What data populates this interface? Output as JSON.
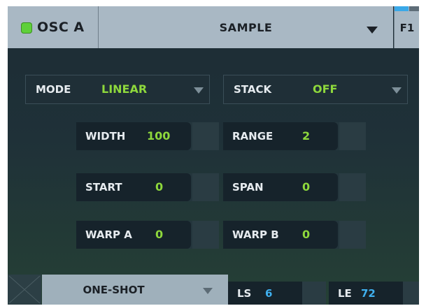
{
  "header": {
    "osc_label": "OSC A",
    "osc_enabled": true,
    "sample_label": "SAMPLE",
    "filter_label": "F1"
  },
  "dropdowns": {
    "mode": {
      "label": "MODE",
      "value": "LINEAR"
    },
    "stack": {
      "label": "STACK",
      "value": "OFF"
    }
  },
  "knobs": {
    "width": {
      "label": "WIDTH",
      "value": "100"
    },
    "range": {
      "label": "RANGE",
      "value": "2"
    },
    "start": {
      "label": "START",
      "value": "0"
    },
    "span": {
      "label": "SPAN",
      "value": "0"
    },
    "warp_a": {
      "label": "WARP A",
      "value": "0"
    },
    "warp_b": {
      "label": "WARP B",
      "value": "0"
    }
  },
  "footer": {
    "loop_mode": "ONE-SHOT",
    "ls": {
      "label": "LS",
      "value": "6"
    },
    "le": {
      "label": "LE",
      "value": "72"
    }
  },
  "colors": {
    "accent_green": "#8ed83c",
    "accent_blue": "#3fb0ef",
    "led_green": "#5fd03a"
  }
}
